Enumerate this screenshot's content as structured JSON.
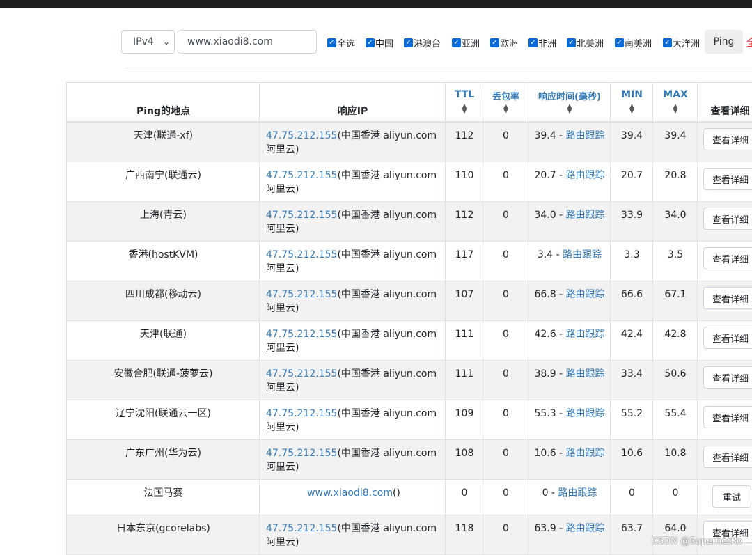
{
  "controls": {
    "ip_version": "IPv4",
    "host": "www.xiaodi8.com",
    "regions": [
      "全选",
      "中国",
      "港澳台",
      "亚洲",
      "欧洲",
      "非洲",
      "北美洲",
      "南美洲",
      "大洋洲"
    ],
    "ping_button": "Ping",
    "extra_glyph": "全"
  },
  "table": {
    "headers": {
      "location": "Ping的地点",
      "ip": "响应IP",
      "ttl": "TTL",
      "loss": "丢包率",
      "rtt": "响应时间(毫秒)",
      "min": "MIN",
      "max": "MAX",
      "detail": "查看详细"
    },
    "rows": [
      {
        "location": "天津(联通-xf)",
        "ip": "47.75.212.155",
        "ip_info": "(中国香港 aliyun.com 阿里云)",
        "ttl": "112",
        "loss": "0",
        "rtt": "39.4",
        "trace": "路由跟踪",
        "min": "39.4",
        "max": "39.4",
        "action": "查看详细"
      },
      {
        "location": "广西南宁(联通云)",
        "ip": "47.75.212.155",
        "ip_info": "(中国香港 aliyun.com 阿里云)",
        "ttl": "110",
        "loss": "0",
        "rtt": "20.7",
        "trace": "路由跟踪",
        "min": "20.7",
        "max": "20.8",
        "action": "查看详细"
      },
      {
        "location": "上海(青云)",
        "ip": "47.75.212.155",
        "ip_info": "(中国香港 aliyun.com 阿里云)",
        "ttl": "112",
        "loss": "0",
        "rtt": "34.0",
        "trace": "路由跟踪",
        "min": "33.9",
        "max": "34.0",
        "action": "查看详细"
      },
      {
        "location": "香港(hostKVM)",
        "ip": "47.75.212.155",
        "ip_info": "(中国香港 aliyun.com 阿里云)",
        "ttl": "117",
        "loss": "0",
        "rtt": "3.4",
        "trace": "路由跟踪",
        "min": "3.3",
        "max": "3.5",
        "action": "查看详细"
      },
      {
        "location": "四川成都(移动云)",
        "ip": "47.75.212.155",
        "ip_info": "(中国香港 aliyun.com 阿里云)",
        "ttl": "107",
        "loss": "0",
        "rtt": "66.8",
        "trace": "路由跟踪",
        "min": "66.6",
        "max": "67.1",
        "action": "查看详细"
      },
      {
        "location": "天津(联通)",
        "ip": "47.75.212.155",
        "ip_info": "(中国香港 aliyun.com 阿里云)",
        "ttl": "111",
        "loss": "0",
        "rtt": "42.6",
        "trace": "路由跟踪",
        "min": "42.4",
        "max": "42.8",
        "action": "查看详细"
      },
      {
        "location": "安徽合肥(联通-菠萝云)",
        "ip": "47.75.212.155",
        "ip_info": "(中国香港 aliyun.com 阿里云)",
        "ttl": "111",
        "loss": "0",
        "rtt": "38.9",
        "trace": "路由跟踪",
        "min": "33.4",
        "max": "50.6",
        "action": "查看详细"
      },
      {
        "location": "辽宁沈阳(联通云一区)",
        "ip": "47.75.212.155",
        "ip_info": "(中国香港 aliyun.com 阿里云)",
        "ttl": "109",
        "loss": "0",
        "rtt": "55.3",
        "trace": "路由跟踪",
        "min": "55.2",
        "max": "55.4",
        "action": "查看详细"
      },
      {
        "location": "广东广州(华为云)",
        "ip": "47.75.212.155",
        "ip_info": "(中国香港 aliyun.com 阿里云)",
        "ttl": "108",
        "loss": "0",
        "rtt": "10.6",
        "trace": "路由跟踪",
        "min": "10.6",
        "max": "10.8",
        "action": "查看详细"
      },
      {
        "location": "法国马赛",
        "ip": "www.xiaodi8.com",
        "ip_info": "()",
        "ttl": "0",
        "loss": "0",
        "rtt": "0",
        "trace": "路由跟踪",
        "min": "0",
        "max": "0",
        "action": "重试"
      },
      {
        "location": "日本东京(gcorelabs)",
        "ip": "47.75.212.155",
        "ip_info": "(中国香港 aliyun.com 阿里云)",
        "ttl": "118",
        "loss": "0",
        "rtt": "63.9",
        "trace": "路由跟踪",
        "min": "63.7",
        "max": "64.0",
        "action": "查看详细"
      }
    ]
  },
  "watermark": "CSDN @SuperherRo"
}
